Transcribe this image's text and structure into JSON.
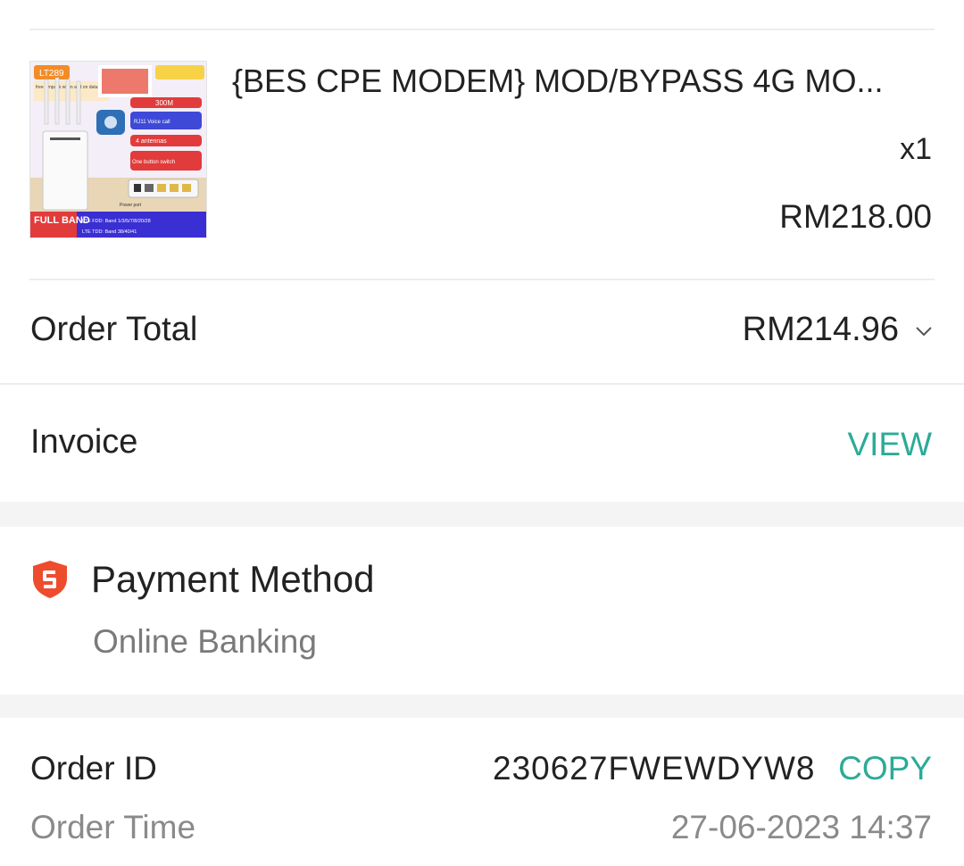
{
  "product": {
    "name": "{BES CPE MODEM} MOD/BYPASS 4G MO...",
    "quantity": "x1",
    "price": "RM218.00",
    "image_text": {
      "model_badge": "LT289",
      "simpack": "free simpack when add on data plan",
      "speed": "300M",
      "voice": "RJ11 Voice call",
      "antennas": "4 antennas",
      "switch": "One button switch",
      "full_band": "FULL BAND",
      "lte_fdd": "LTE FDD: Band 1/3/5/7/8/20/28",
      "lte_tdd": "LTE TDD: Band 38/40/41",
      "power": "Power port"
    }
  },
  "order_total": {
    "label": "Order Total",
    "value": "RM214.96"
  },
  "invoice": {
    "label": "Invoice",
    "action": "VIEW"
  },
  "payment": {
    "title": "Payment Method",
    "method": "Online Banking"
  },
  "order_info": {
    "id_label": "Order ID",
    "id_value": "230627FWEWDYW8",
    "copy_label": "COPY",
    "time_label": "Order Time",
    "time_value": "27-06-2023 14:37"
  },
  "colors": {
    "accent": "#2bab97",
    "shield": "#ee4d2d"
  },
  "icons": {
    "expand": "chevron-down-icon",
    "payment": "shield-icon"
  }
}
